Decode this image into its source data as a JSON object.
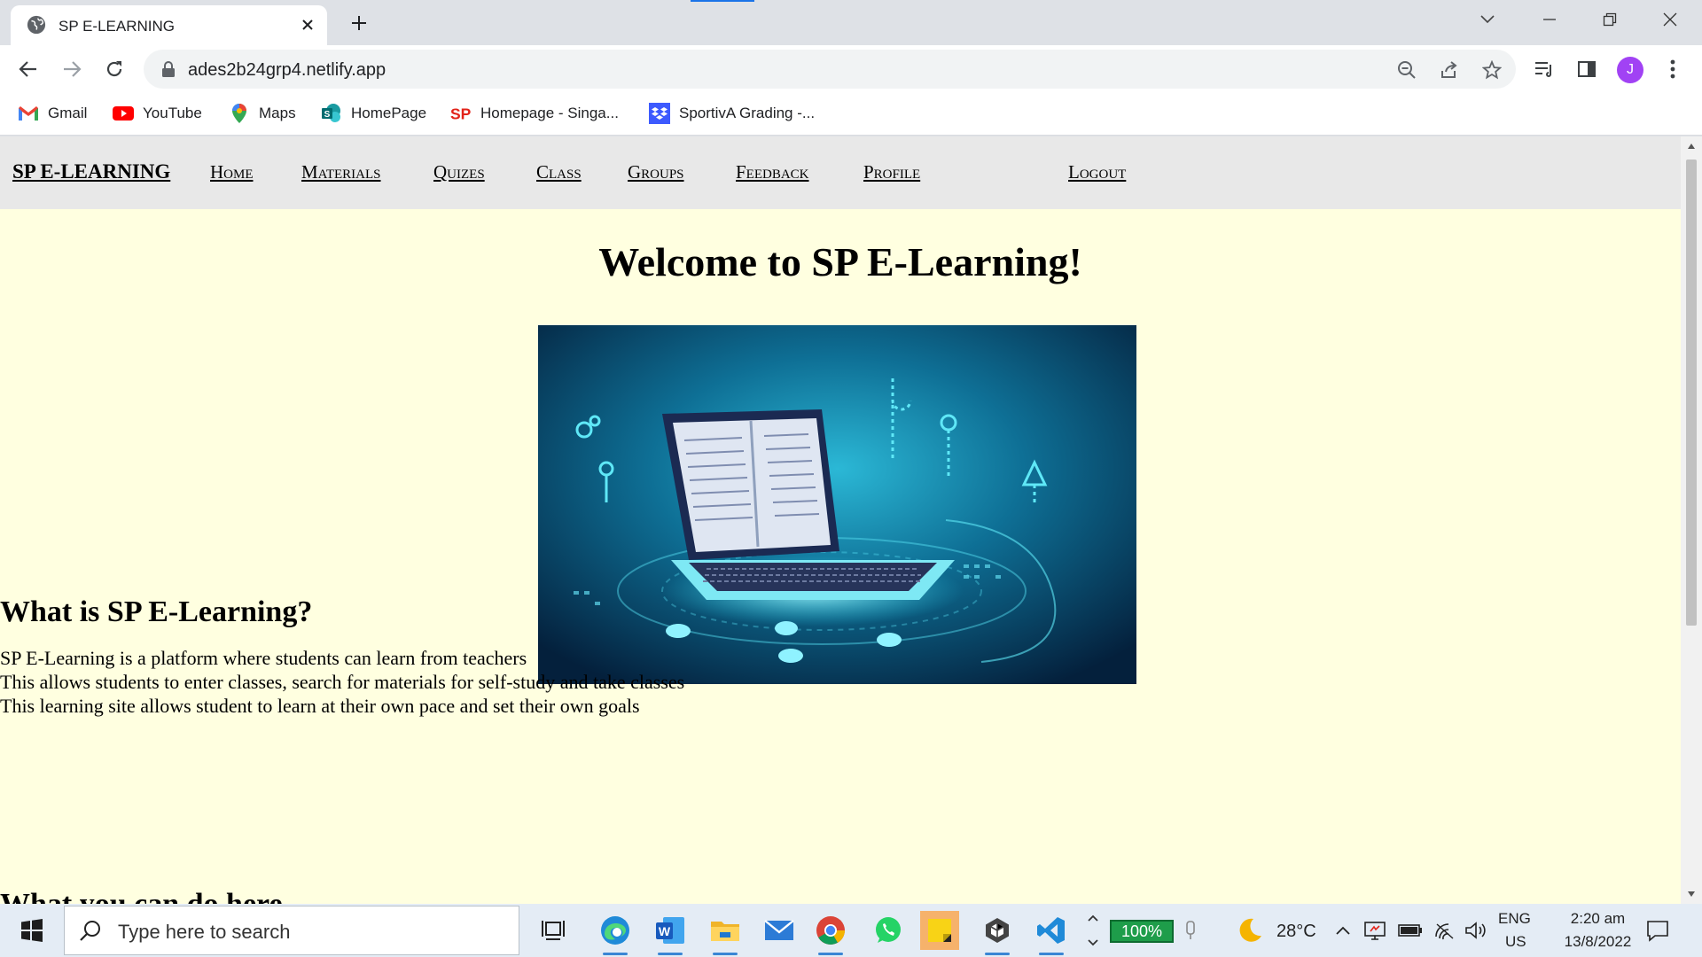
{
  "browser": {
    "tab_title": "SP E-LEARNING",
    "url": "ades2b24grp4.netlify.app",
    "profile_initial": "J",
    "bookmarks": [
      {
        "label": "Gmail",
        "icon": "gmail-icon"
      },
      {
        "label": "YouTube",
        "icon": "youtube-icon"
      },
      {
        "label": "Maps",
        "icon": "maps-icon"
      },
      {
        "label": "HomePage",
        "icon": "sharepoint-icon"
      },
      {
        "label": "Homepage - Singa...",
        "icon": "sp-logo-icon"
      },
      {
        "label": "SportivA Grading -...",
        "icon": "dropbox-icon"
      }
    ]
  },
  "site": {
    "brand": "SP E-LEARNING",
    "nav": [
      "Home",
      "Materials",
      "Quizes",
      "Class",
      "Groups",
      "Feedback",
      "Profile"
    ],
    "logout": "Logout",
    "welcome": "Welcome to SP E-Learning!",
    "section_title": "What is SP E-Learning?",
    "paragraph": [
      "SP E-Learning is a platform where students can learn from teachers",
      "This allows students to enter classes, search for materials for self-study and take classes",
      "This learning site allows student to learn at their own pace and set their own goals"
    ],
    "next_section_title": "What you can do here"
  },
  "taskbar": {
    "search_placeholder": "Type here to search",
    "battery_level": "100%",
    "weather": "28°C",
    "language": "ENG",
    "region": "US",
    "time": "2:20 am",
    "date": "13/8/2022"
  },
  "colors": {
    "page_background": "#ffffe0",
    "navbar_background": "#e8e8e8",
    "avatar": "#a142f4",
    "battery": "#1e9d4a"
  }
}
